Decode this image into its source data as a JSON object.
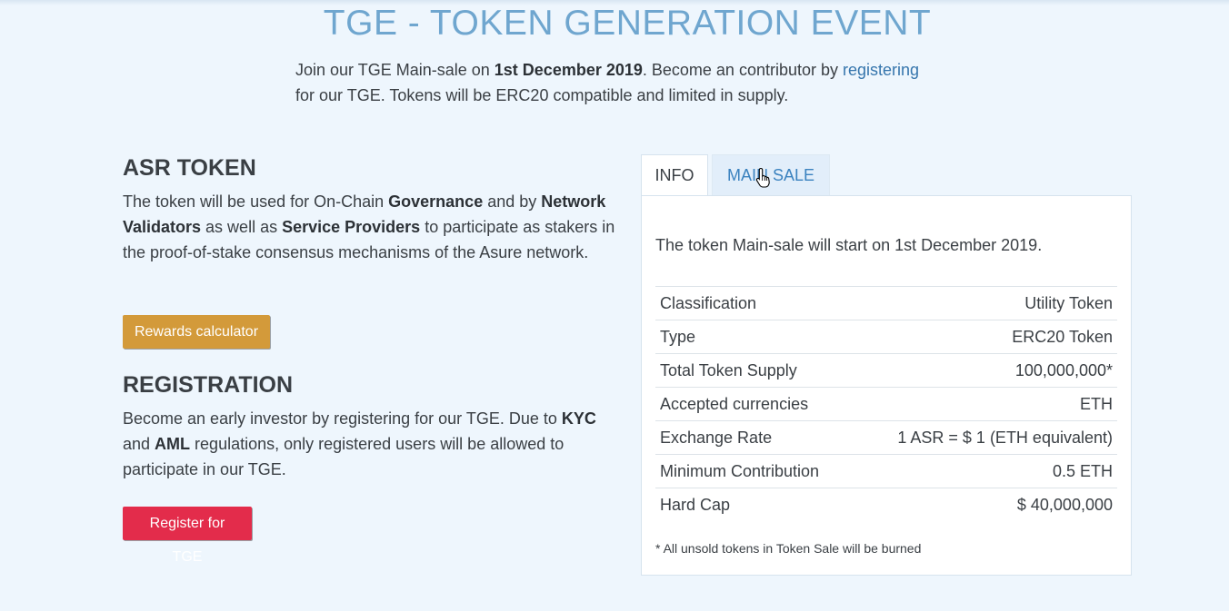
{
  "header": {
    "title": "TGE - TOKEN GENERATION EVENT",
    "intro_prefix": "Join our TGE Main-sale on ",
    "intro_date": "1st December 2019",
    "intro_mid": ". Become an contributor by ",
    "intro_link": "registering",
    "intro_suffix": "for our TGE. Tokens will be ERC20 compatible and limited in supply."
  },
  "asr": {
    "heading": "ASR TOKEN",
    "t1": "The token will be used for On-Chain ",
    "b1": "Governance",
    "t2": " and by ",
    "b2": "Network Validators",
    "t3": " as well as ",
    "b3": "Service Providers",
    "t4": " to participate as stakers in the proof-of-stake consensus mechanisms of the Asure network.",
    "button": "Rewards calculator"
  },
  "registration": {
    "heading": "REGISTRATION",
    "t1": "Become an early investor by registering for our TGE. Due to ",
    "b1": "KYC",
    "t2": " and ",
    "b2": "AML",
    "t3": " regulations, only registered users will be allowed to participate in our TGE.",
    "button": "Register for TGE"
  },
  "tabs": {
    "info": "INFO",
    "main_sale": "MAIN SALE"
  },
  "info_panel": {
    "intro": "The token Main-sale will start on 1st December 2019.",
    "rows": [
      {
        "label": "Classification",
        "value": "Utility Token"
      },
      {
        "label": "Type",
        "value": "ERC20 Token"
      },
      {
        "label": "Total Token Supply",
        "value": "100,000,000*"
      },
      {
        "label": "Accepted currencies",
        "value": "ETH"
      },
      {
        "label": "Exchange Rate",
        "value": "1 ASR = $ 1 (ETH equivalent)"
      },
      {
        "label": "Minimum Contribution",
        "value": "0.5 ETH"
      },
      {
        "label": "Hard Cap",
        "value": "$ 40,000,000"
      }
    ],
    "footnote": "* All unsold tokens in Token Sale will be burned"
  },
  "colors": {
    "accent": "#6fa6cf",
    "link": "#3676ad",
    "rewards": "#d39a3a",
    "register": "#e32c4b"
  }
}
